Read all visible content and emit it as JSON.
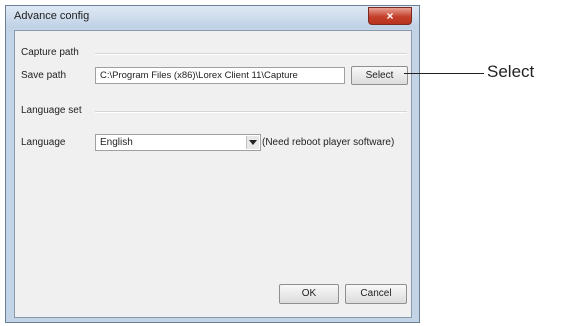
{
  "window": {
    "title": "Advance config",
    "close_glyph": "×"
  },
  "capture": {
    "group_label": "Capture path",
    "save_path_label": "Save path",
    "save_path_value": "C:\\Program Files (x86)\\Lorex Client 11\\Capture",
    "select_label": "Select"
  },
  "language": {
    "group_label": "Language set",
    "label": "Language",
    "selected": "English",
    "note": "(Need reboot player software)"
  },
  "footer": {
    "ok_label": "OK",
    "cancel_label": "Cancel"
  },
  "callout": {
    "label": "Select"
  },
  "colors": {
    "close_button": "#c4402b",
    "frame": "#c3d4e6",
    "client": "#f0f0f0"
  }
}
